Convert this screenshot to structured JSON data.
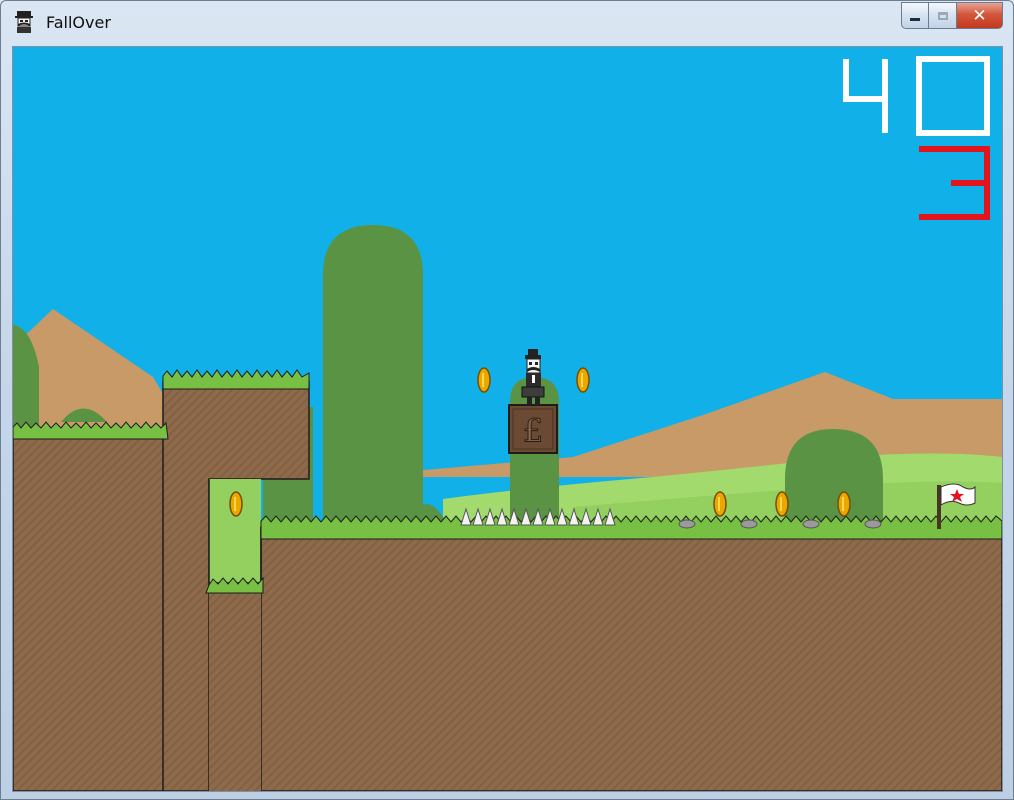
{
  "window": {
    "title": "FallOver",
    "icon": "mustache-man-icon",
    "buttons": [
      "minimize",
      "maximize",
      "close"
    ],
    "close_glyph": "✕"
  },
  "hud": {
    "coins": "40",
    "lives": "3",
    "coins_color": "#ffffff",
    "lives_color": "#e4141d"
  },
  "block": {
    "label": "£"
  },
  "colors": {
    "sky": "#12b0e8",
    "dirt": "#8d6a4c",
    "grass": "#78c043",
    "hills": "#5a9343",
    "mountains": "#c79a67",
    "coin": "#e8a800"
  }
}
